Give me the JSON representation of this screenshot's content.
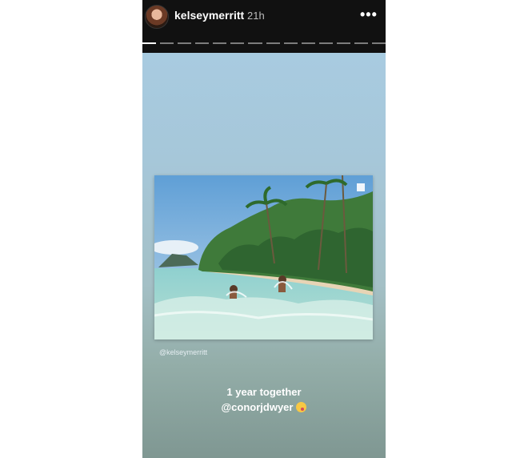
{
  "story": {
    "username": "kelseymerritt",
    "time": "21h",
    "more_icon": "more-horizontal-icon",
    "segments_total": 14,
    "segments_viewed": 1,
    "photo_credit": "@kelseymerritt",
    "caption_line1": "1 year together",
    "caption_line2": "@conorjdwyer",
    "emoji_icon": "winking-face-tongue-icon"
  }
}
